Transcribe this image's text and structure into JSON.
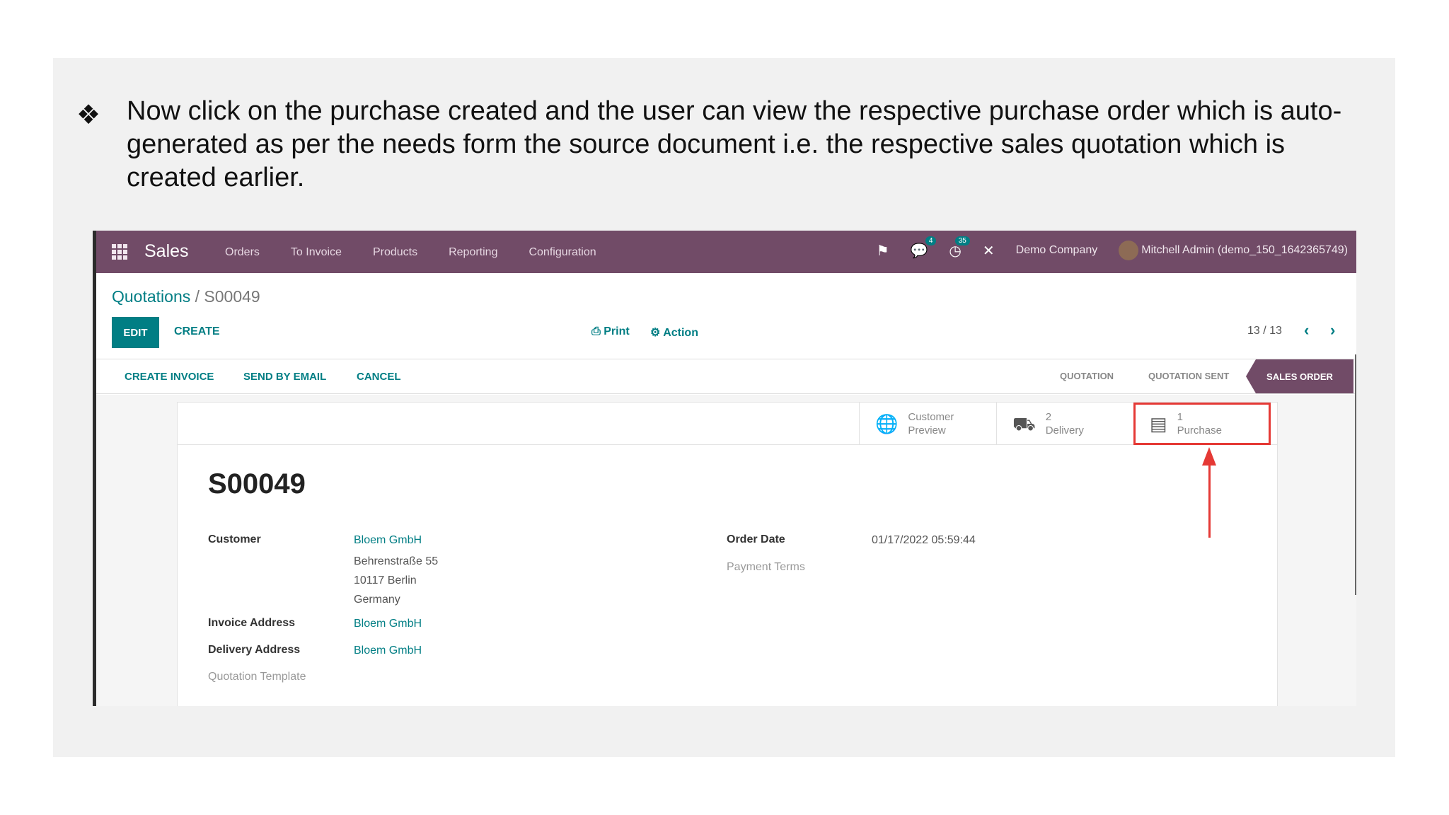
{
  "slide": {
    "bullet": "❖",
    "text": "Now click on the purchase created and the user can view the respective purchase order which is auto-generated as per the needs form the source document i.e. the respective sales quotation which is created earlier."
  },
  "navbar": {
    "app_name": "Sales",
    "menu": [
      "Orders",
      "To Invoice",
      "Products",
      "Reporting",
      "Configuration"
    ],
    "messages_count": "4",
    "activities_count": "35",
    "company": "Demo Company",
    "user": "Mitchell Admin (demo_150_1642365749)"
  },
  "breadcrumb": {
    "parent": "Quotations",
    "separator": " / ",
    "current": "S00049"
  },
  "toolbar": {
    "edit": "EDIT",
    "create": "CREATE",
    "print": "Print",
    "action": "Action",
    "pager": "13 / 13"
  },
  "statusbar": {
    "buttons": [
      "CREATE INVOICE",
      "SEND BY EMAIL",
      "CANCEL"
    ],
    "stages": [
      "QUOTATION",
      "QUOTATION SENT",
      "SALES ORDER"
    ],
    "active_stage": "SALES ORDER"
  },
  "smart_buttons": [
    {
      "line1": "Customer",
      "line2": "Preview",
      "icon": "globe-icon"
    },
    {
      "line1": "2",
      "line2": "Delivery",
      "icon": "truck-icon"
    },
    {
      "line1": "1",
      "line2": "Purchase",
      "icon": "credit-card-icon"
    }
  ],
  "form": {
    "title": "S00049",
    "customer_label": "Customer",
    "customer_name": "Bloem GmbH",
    "customer_street": "Behrenstraße 55",
    "customer_city": "10117 Berlin",
    "customer_country": "Germany",
    "invoice_address_label": "Invoice Address",
    "invoice_address": "Bloem GmbH",
    "delivery_address_label": "Delivery Address",
    "delivery_address": "Bloem GmbH",
    "quotation_template_label": "Quotation Template",
    "order_date_label": "Order Date",
    "order_date": "01/17/2022 05:59:44",
    "payment_terms_label": "Payment Terms"
  },
  "colors": {
    "brand": "#714b67",
    "accent": "#017e84",
    "highlight": "#e53935"
  }
}
